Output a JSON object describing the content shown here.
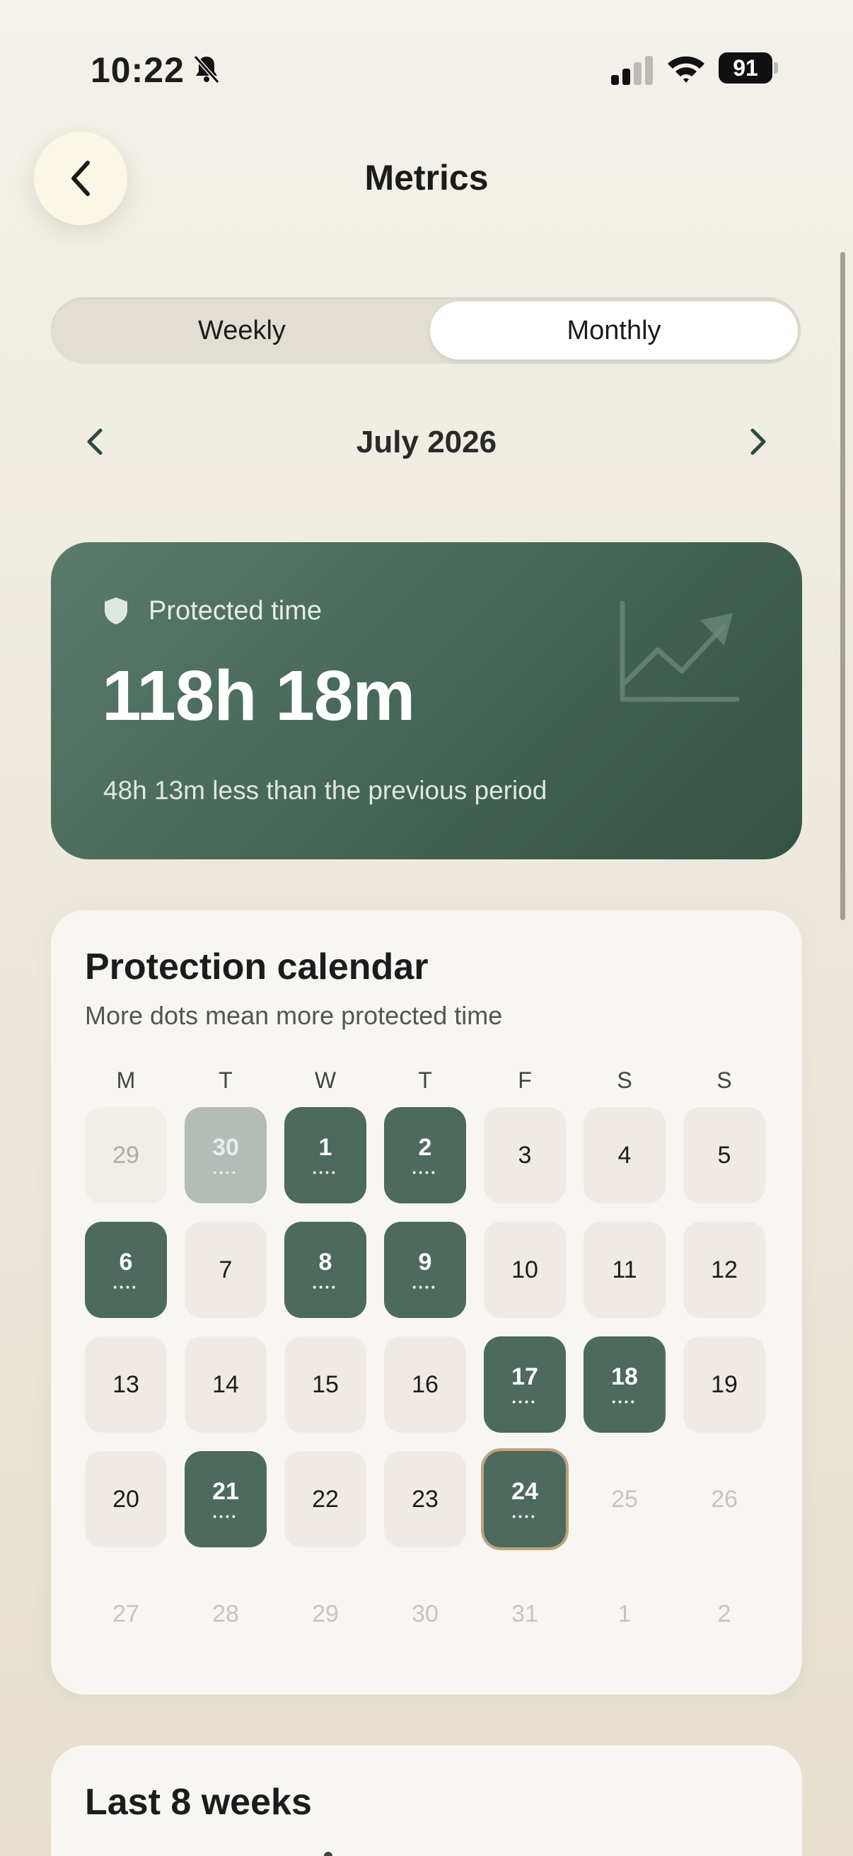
{
  "status_bar": {
    "time": "10:22",
    "battery": "91"
  },
  "header": {
    "title": "Metrics"
  },
  "segments": {
    "weekly": "Weekly",
    "monthly": "Monthly",
    "selected": "Monthly"
  },
  "month_nav": {
    "label": "July 2026"
  },
  "protected": {
    "label": "Protected time",
    "value": "118h 18m",
    "diff": "48h 13m less than the previous period"
  },
  "calendar": {
    "title": "Protection calendar",
    "subtitle": "More dots mean more protected time",
    "weekdays": [
      "M",
      "T",
      "W",
      "T",
      "F",
      "S",
      "S"
    ],
    "weeks": [
      [
        {
          "d": "29",
          "s": "faded"
        },
        {
          "d": "30",
          "s": "active-faded"
        },
        {
          "d": "1",
          "s": "active"
        },
        {
          "d": "2",
          "s": "active"
        },
        {
          "d": "3",
          "s": "normal"
        },
        {
          "d": "4",
          "s": "normal"
        },
        {
          "d": "5",
          "s": "normal"
        }
      ],
      [
        {
          "d": "6",
          "s": "active"
        },
        {
          "d": "7",
          "s": "normal"
        },
        {
          "d": "8",
          "s": "active"
        },
        {
          "d": "9",
          "s": "active"
        },
        {
          "d": "10",
          "s": "normal"
        },
        {
          "d": "11",
          "s": "normal"
        },
        {
          "d": "12",
          "s": "normal"
        }
      ],
      [
        {
          "d": "13",
          "s": "normal"
        },
        {
          "d": "14",
          "s": "normal"
        },
        {
          "d": "15",
          "s": "normal"
        },
        {
          "d": "16",
          "s": "normal"
        },
        {
          "d": "17",
          "s": "active"
        },
        {
          "d": "18",
          "s": "active"
        },
        {
          "d": "19",
          "s": "normal"
        }
      ],
      [
        {
          "d": "20",
          "s": "normal"
        },
        {
          "d": "21",
          "s": "active"
        },
        {
          "d": "22",
          "s": "normal"
        },
        {
          "d": "23",
          "s": "normal"
        },
        {
          "d": "24",
          "s": "today"
        },
        {
          "d": "25",
          "s": "future"
        },
        {
          "d": "26",
          "s": "future"
        }
      ],
      [
        {
          "d": "27",
          "s": "future"
        },
        {
          "d": "28",
          "s": "future"
        },
        {
          "d": "29",
          "s": "future"
        },
        {
          "d": "30",
          "s": "future"
        },
        {
          "d": "31",
          "s": "future"
        },
        {
          "d": "1",
          "s": "future"
        },
        {
          "d": "2",
          "s": "future"
        }
      ]
    ],
    "dots": "••••"
  },
  "weeks_card": {
    "title": "Last 8 weeks"
  },
  "colors": {
    "accent": "#4c6a5d",
    "card_green": "#466657",
    "today_ring": "#bfa27d"
  }
}
